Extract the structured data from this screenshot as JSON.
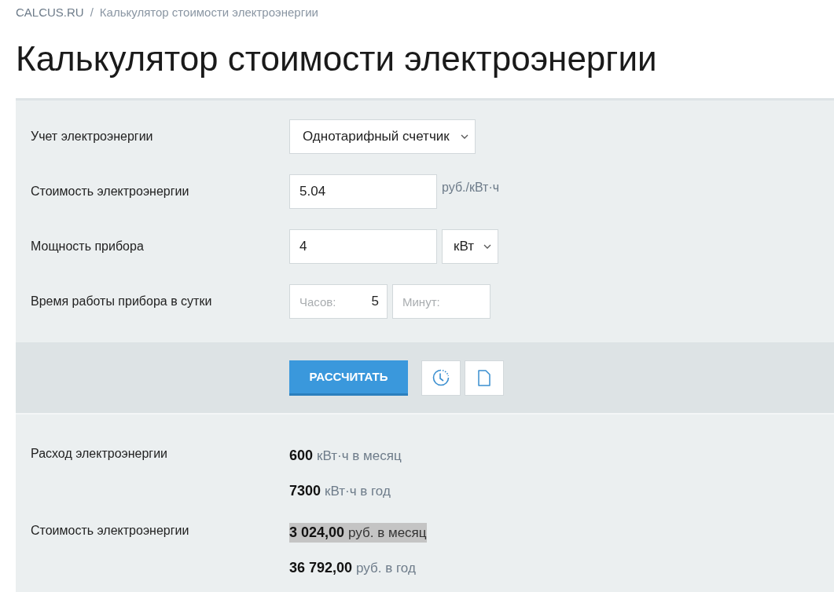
{
  "breadcrumb": {
    "items": [
      "CALCUS.RU",
      "Калькулятор стоимости электроэнергии"
    ],
    "separator": "/"
  },
  "title": "Калькулятор стоимости электроэнергии",
  "form": [
    {
      "kind": "select",
      "label": "Учет электроэнергии",
      "value": "Однотарифный счетчик"
    },
    {
      "kind": "input_unit",
      "label": "Стоимость электроэнергии",
      "value": "5.04",
      "unit": "руб./кВт·ч"
    },
    {
      "kind": "input_select",
      "label": "Мощность прибора",
      "value": "4",
      "select": "кВт"
    },
    {
      "kind": "time",
      "label": "Время работы прибора в сутки",
      "fields": [
        {
          "label": "Часов:",
          "value": "5"
        },
        {
          "label": "Минут:"
        }
      ]
    }
  ],
  "actions": {
    "calculate": "РАССЧИТАТЬ"
  },
  "results": [
    {
      "label": "Расход электроэнергии",
      "lines": [
        {
          "value": "600",
          "unit": "кВт·ч в месяц",
          "highlighted": false
        },
        {
          "value": "7300",
          "unit": "кВт·ч в год",
          "highlighted": false
        }
      ]
    },
    {
      "label": "Стоимость электроэнергии",
      "lines": [
        {
          "value": "3 024,00",
          "unit": "руб. в месяц",
          "highlighted": true
        },
        {
          "value": "36 792,00",
          "unit": "руб. в год",
          "highlighted": false
        }
      ]
    }
  ]
}
